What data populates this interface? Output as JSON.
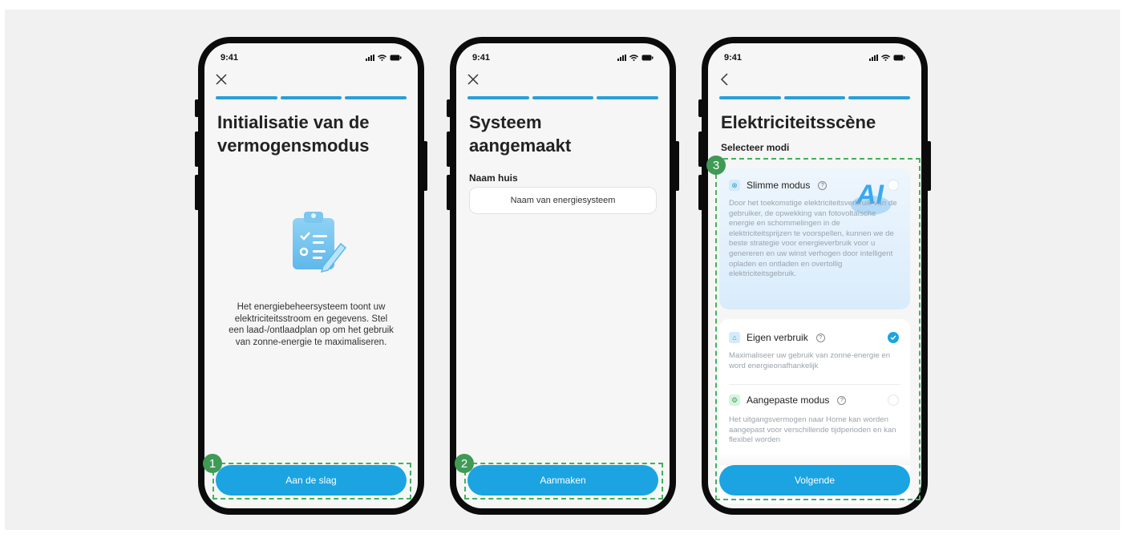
{
  "colors": {
    "accent": "#1ba4e1",
    "badge": "#3f9a55",
    "dashed": "#3fb35c"
  },
  "screen1": {
    "time": "9:41",
    "nav_icon": "close-icon",
    "title": "Initialisatie van de vermogensmodus",
    "illustration": "clipboard-checklist-icon",
    "description": "Het energiebeheersysteem toont uw elektriciteitsstroom en gegevens. Stel een laad-/ontlaadplan op om het gebruik van zonne-energie te maximaliseren.",
    "button_label": "Aan de slag",
    "badge": "1"
  },
  "screen2": {
    "time": "9:41",
    "nav_icon": "close-icon",
    "title": "Systeem aangemaakt",
    "field_label": "Naam huis",
    "input_placeholder": "Naam van energiesysteem",
    "button_label": "Aanmaken",
    "badge": "2"
  },
  "screen3": {
    "time": "9:41",
    "nav_icon": "back-chevron-icon",
    "title": "Elektriciteitsscène",
    "subtitle": "Selecteer modi",
    "badge": "3",
    "modes": [
      {
        "name": "Slimme modus",
        "icon": "smart-mode-icon",
        "description": "Door het toekomstige elektriciteitsverbruik van de gebruiker, de opwekking van fotovoltaïsche energie en schommelingen in de elektriciteitsprijzen te voorspellen, kunnen we de beste strategie voor energieverbruik voor u genereren en uw winst verhogen door intelligent opladen en ontladen en overtollig elektriciteitsgebruik.",
        "selected": false,
        "graphic": "AI"
      },
      {
        "name": "Eigen verbruik",
        "icon": "home-icon",
        "description": "Maximaliseer uw gebruik van zonne-energie en word energieonafhankelijk",
        "selected": true
      },
      {
        "name": "Aangepaste modus",
        "icon": "settings-icon",
        "description": "Het uitgangsvermogen naar Home kan worden aangepast voor verschillende tijdperioden en kan flexibel worden",
        "selected": false
      }
    ],
    "button_label": "Volgende"
  }
}
